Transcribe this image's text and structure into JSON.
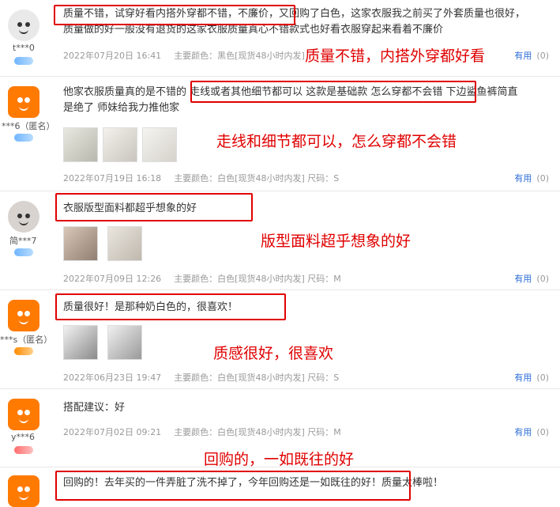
{
  "reviews": [
    {
      "user": "t***0",
      "text_lines": [
        "质量不错，试穿好看内搭外穿都不错，不廉价，又回购了白色，这家衣服我之前买了外套质量也很好，",
        "质量做的好一般没有退货的这家衣服质量真心不错款式也好看衣服穿起来看着不廉价"
      ],
      "date": "2022年07月20日 16:41",
      "spec": "主要颜色：黑色[现货48小时内发]",
      "useful_label": "有用",
      "useful_count": "(0)",
      "annotation": "质量不错，内搭外穿都好看"
    },
    {
      "user": "***6（匿名）",
      "text_lines": [
        "他家衣服质量真的是不错的 走线或者其他细节都可以 这款是基础款 怎么穿都不会错 下边鲨鱼裤简直",
        "是绝了 师妹给我力推他家"
      ],
      "date": "2022年07月19日 16:18",
      "spec": "主要颜色：白色[现货48小时内发] 尺码：S",
      "useful_label": "有用",
      "useful_count": "(0)",
      "annotation": "走线和细节都可以，怎么穿都不会错"
    },
    {
      "user": "简***7",
      "text_lines": [
        "衣服版型面料都超乎想象的好"
      ],
      "date": "2022年07月09日 12:26",
      "spec": "主要颜色：白色[现货48小时内发] 尺码：M",
      "useful_label": "有用",
      "useful_count": "(0)",
      "annotation": "版型面料超乎想象的好"
    },
    {
      "user": "***s（匿名）",
      "text_lines": [
        "质量很好！是那种奶白色的，很喜欢！"
      ],
      "date": "2022年06月23日 19:47",
      "spec": "主要颜色：白色[现货48小时内发] 尺码：S",
      "useful_label": "有用",
      "useful_count": "(0)",
      "annotation": "质感很好，很喜欢"
    },
    {
      "user": "y***6",
      "text_lines": [
        "搭配建议：好"
      ],
      "date": "2022年07月02日 09:21",
      "spec": "主要颜色：白色[现货48小时内发] 尺码：M",
      "useful_label": "有用",
      "useful_count": "(0)",
      "annotation": "回购的，一如既往的好"
    },
    {
      "user": "",
      "text_lines": [
        "回购的！去年买的一件弄脏了洗不掉了，今年回购还是一如既往的好！质量太棒啦！"
      ]
    }
  ]
}
